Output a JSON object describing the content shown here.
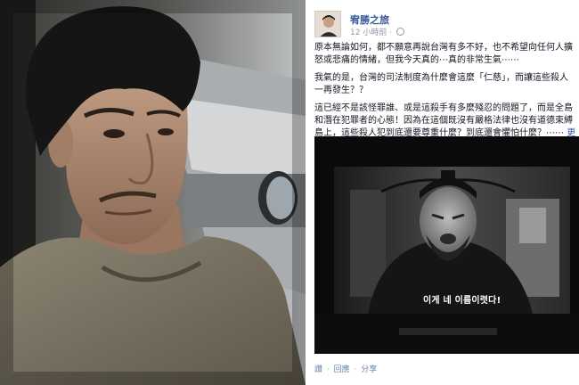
{
  "post": {
    "author": "宥勝之旅",
    "time": "12 小時前",
    "paragraphs": [
      [
        "原本無論如何，都不願意再說台灣有多不好，也不希望向任何人擴",
        "怒或悲痛的情緒，但我今天真的⋯真的非常生氣⋯⋯"
      ],
      [
        "我氣的是，台灣的司法制度為什麼會這麼「仁慈」，而讓這些殺人",
        "一再發生？？"
      ],
      [
        "這已經不是該怪罪誰、或是這殺手有多麼殘忍的問題了，而是全島",
        "和潛在犯罪者的心態！因為在這個既沒有嚴格法律也沒有道德束縛",
        "島上，這些殺人犯到底還要尊重什麼？到底還會懼怕什麼？⋯⋯"
      ]
    ],
    "more_label": "更",
    "tv_subtitle": "이게 네 이름이렷다!",
    "actions": {
      "like": "讚",
      "comment": "回應",
      "share": "分享",
      "separator": "·"
    }
  }
}
